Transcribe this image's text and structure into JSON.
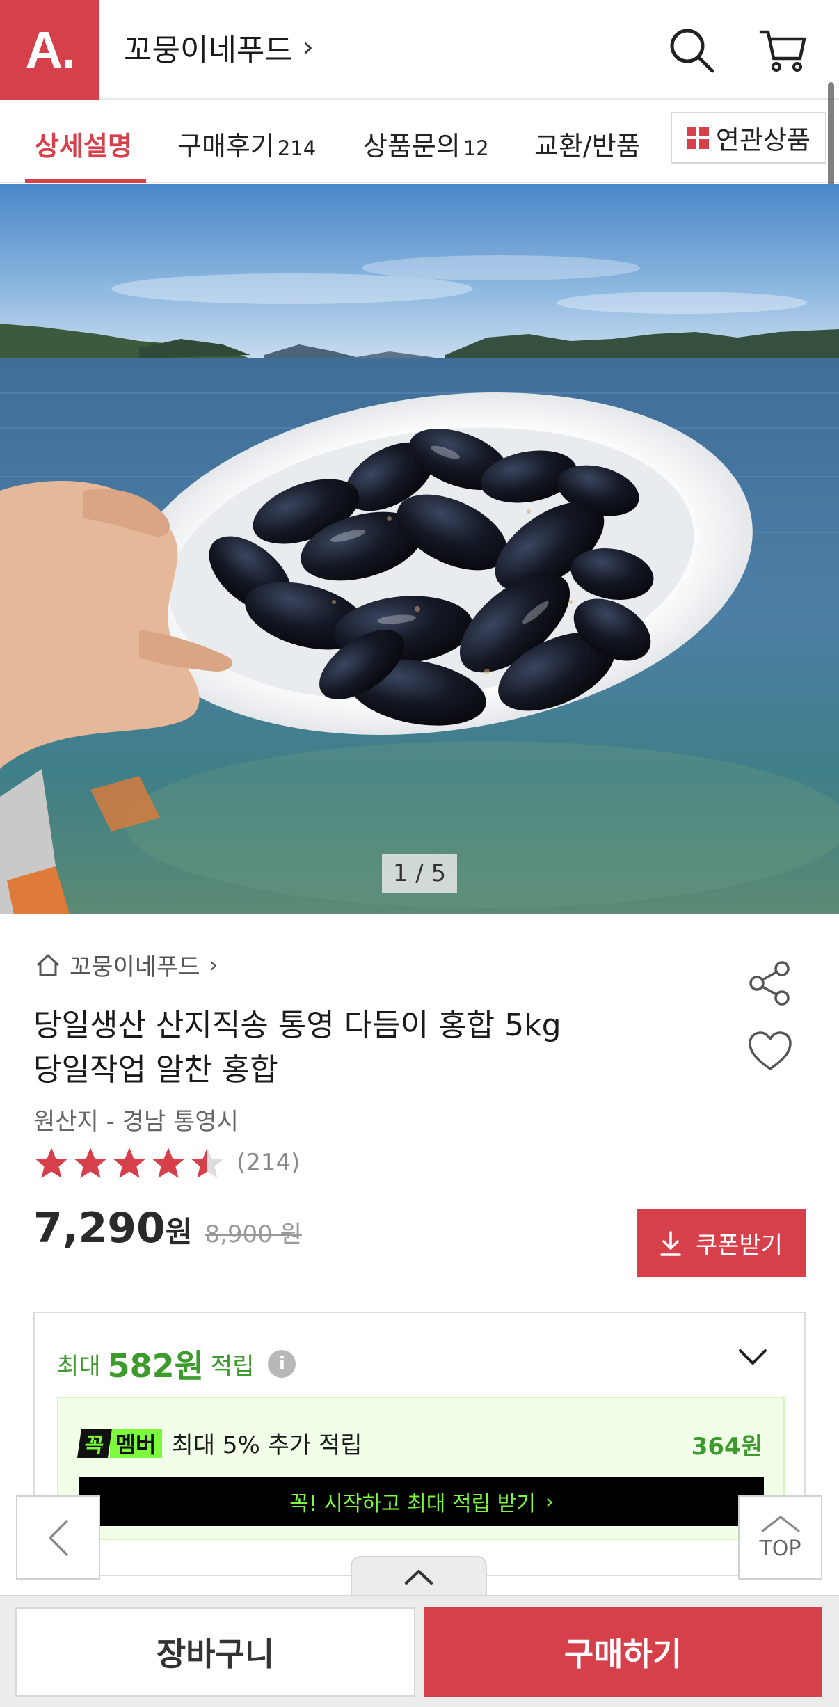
{
  "header": {
    "logo": "A.",
    "store_name": "꼬뭉이네푸드",
    "icons": [
      "search-icon",
      "cart-icon"
    ]
  },
  "tabs": {
    "items": [
      {
        "label": "상세설명",
        "count": ""
      },
      {
        "label": "구매후기",
        "count": "214"
      },
      {
        "label": "상품문의",
        "count": "12"
      },
      {
        "label": "교환/반품",
        "count": ""
      }
    ],
    "related_label": "연관상품"
  },
  "gallery": {
    "pager": "1 / 5"
  },
  "product": {
    "breadcrumb": "꼬뭉이네푸드",
    "title_line1": "당일생산 산지직송 통영 다듬이 홍합 5kg",
    "title_line2": "당일작업 알찬 홍합",
    "origin": "원산지 - 경남 통영시",
    "rating_value": 4.5,
    "review_count": "(214)",
    "price": "7,290",
    "price_unit": "원",
    "original_price": "8,900 원",
    "coupon_label": "쿠폰받기"
  },
  "points": {
    "prefix": "최대",
    "amount": "582원",
    "suffix": "적립",
    "member_badge_1": "꼭",
    "member_badge_2": "멤버",
    "member_text": "최대 5% 추가 적립",
    "member_amount": "364원",
    "cta": "꼭! 시작하고 최대 적립 받기"
  },
  "floating": {
    "top_label": "TOP"
  },
  "bottom_bar": {
    "cart_label": "장바구니",
    "buy_label": "구매하기"
  },
  "colors": {
    "brand": "#d6404a",
    "points_green": "#3d9a2c",
    "member_neon": "#7dfa3e"
  }
}
